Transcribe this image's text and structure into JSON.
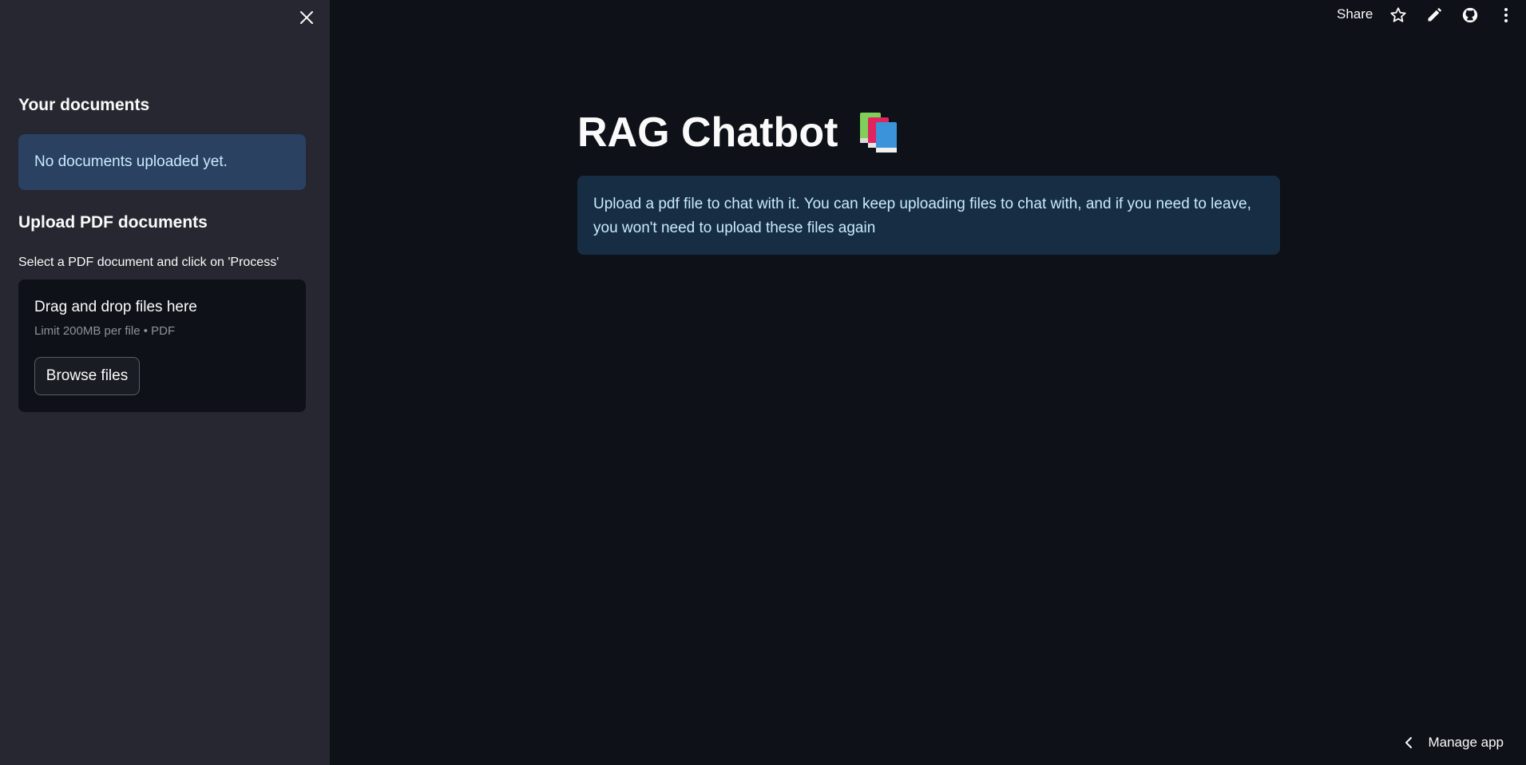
{
  "sidebar": {
    "documents_heading": "Your documents",
    "no_documents_text": "No documents uploaded yet.",
    "upload_heading": "Upload PDF documents",
    "upload_label": "Select a PDF document and click on 'Process'",
    "dropzone": {
      "title": "Drag and drop files here",
      "subtitle": "Limit 200MB per file • PDF",
      "browse_label": "Browse files"
    },
    "close_icon": "close-icon"
  },
  "toolbar": {
    "share_label": "Share",
    "icons": [
      "star-icon",
      "pencil-icon",
      "github-icon",
      "more-vertical-icon"
    ]
  },
  "main": {
    "title": "RAG Chatbot",
    "title_icon": "books-icon",
    "info_text": "Upload a pdf file to chat with it. You can keep uploading files to chat with, and if you need to leave, you won't need to upload these files again"
  },
  "footer": {
    "manage_app_label": "Manage app",
    "manage_icon": "chevron-left-icon"
  },
  "colors": {
    "background": "#0e1117",
    "sidebar": "#262730",
    "info_bg": "#172d43",
    "info_text": "#c7ebff",
    "no_docs_bg": "#2b4161"
  }
}
